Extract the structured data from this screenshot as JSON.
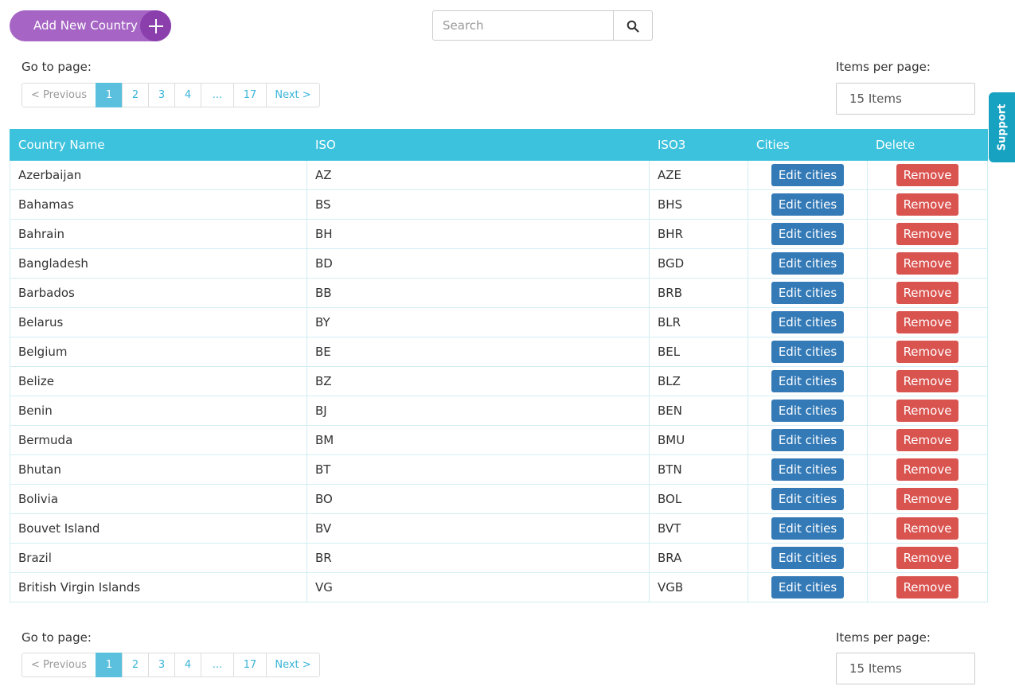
{
  "header": {
    "add_button_label": "Add New Country",
    "search_placeholder": "Search"
  },
  "pagination": {
    "go_to_label": "Go to page:",
    "prev_label": "< Previous",
    "pages": [
      "1",
      "2",
      "3",
      "4",
      "...",
      "17"
    ],
    "active_page": "1",
    "next_label": "Next >"
  },
  "items_per_page": {
    "label": "Items per page:",
    "value": "15 Items"
  },
  "support_label": "Support",
  "table": {
    "columns": [
      "Country Name",
      "ISO",
      "ISO3",
      "Cities",
      "Delete"
    ],
    "edit_label": "Edit cities",
    "remove_label": "Remove",
    "rows": [
      {
        "name": "Azerbaijan",
        "iso": "AZ",
        "iso3": "AZE"
      },
      {
        "name": "Bahamas",
        "iso": "BS",
        "iso3": "BHS"
      },
      {
        "name": "Bahrain",
        "iso": "BH",
        "iso3": "BHR"
      },
      {
        "name": "Bangladesh",
        "iso": "BD",
        "iso3": "BGD"
      },
      {
        "name": "Barbados",
        "iso": "BB",
        "iso3": "BRB"
      },
      {
        "name": "Belarus",
        "iso": "BY",
        "iso3": "BLR"
      },
      {
        "name": "Belgium",
        "iso": "BE",
        "iso3": "BEL"
      },
      {
        "name": "Belize",
        "iso": "BZ",
        "iso3": "BLZ"
      },
      {
        "name": "Benin",
        "iso": "BJ",
        "iso3": "BEN"
      },
      {
        "name": "Bermuda",
        "iso": "BM",
        "iso3": "BMU"
      },
      {
        "name": "Bhutan",
        "iso": "BT",
        "iso3": "BTN"
      },
      {
        "name": "Bolivia",
        "iso": "BO",
        "iso3": "BOL"
      },
      {
        "name": "Bouvet Island",
        "iso": "BV",
        "iso3": "BVT"
      },
      {
        "name": "Brazil",
        "iso": "BR",
        "iso3": "BRA"
      },
      {
        "name": "British Virgin Islands",
        "iso": "VG",
        "iso3": "VGB"
      }
    ]
  },
  "colors": {
    "add_button": "#a665c4",
    "header_row": "#3dc2dd",
    "edit_button": "#337ab7",
    "remove_button": "#d9534f",
    "support_tab": "#17a2c2"
  },
  "icons": {
    "add": "plus-icon",
    "search": "search-icon"
  }
}
